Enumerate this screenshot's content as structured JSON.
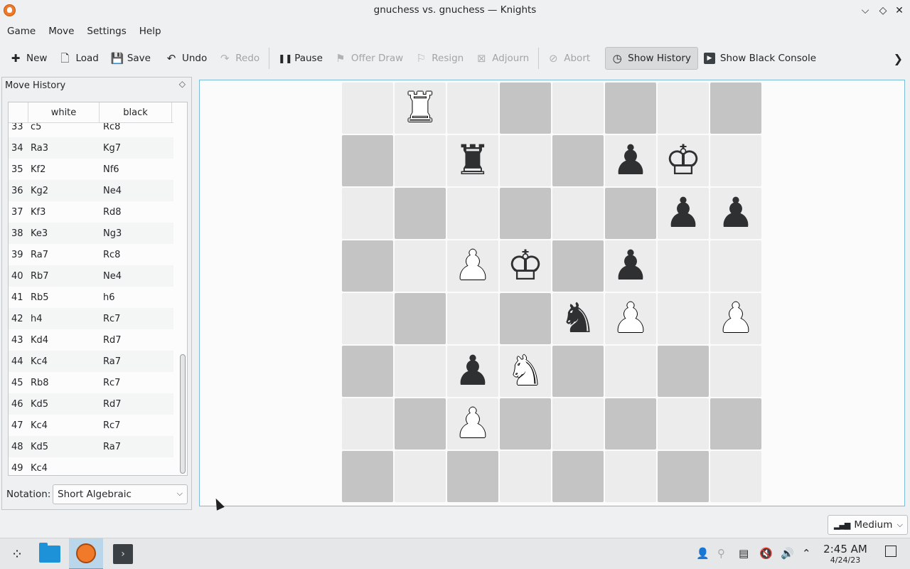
{
  "window": {
    "title": "gnuchess vs. gnuchess — Knights",
    "minimize_glyph": "⌵",
    "maximize_glyph": "◇",
    "close_glyph": "✕"
  },
  "menubar": [
    {
      "label": "Game"
    },
    {
      "label": "Move"
    },
    {
      "label": "Settings"
    },
    {
      "label": "Help"
    }
  ],
  "toolbar": [
    {
      "label": "New",
      "icon": "new-icon",
      "glyph": "✚",
      "enabled": true
    },
    {
      "label": "Load",
      "icon": "load-icon",
      "glyph": "🗋",
      "enabled": true
    },
    {
      "label": "Save",
      "icon": "save-icon",
      "glyph": "💾",
      "enabled": true
    },
    {
      "label": "Undo",
      "icon": "undo-icon",
      "glyph": "↶",
      "enabled": true
    },
    {
      "label": "Redo",
      "icon": "redo-icon",
      "glyph": "↷",
      "enabled": false
    },
    {
      "label": "Pause",
      "icon": "pause-icon",
      "glyph": "❚❚",
      "enabled": true
    },
    {
      "label": "Offer Draw",
      "icon": "flag-icon",
      "glyph": "⚑",
      "enabled": false
    },
    {
      "label": "Resign",
      "icon": "resign-flag-icon",
      "glyph": "⚐",
      "enabled": false
    },
    {
      "label": "Adjourn",
      "icon": "adjourn-icon",
      "glyph": "⊠",
      "enabled": false
    },
    {
      "label": "Abort",
      "icon": "abort-icon",
      "glyph": "⊘",
      "enabled": false
    },
    {
      "label": "Show History",
      "icon": "history-clock-icon",
      "glyph": "◷",
      "enabled": true,
      "active": true
    },
    {
      "label": "Show Black Console",
      "icon": "console-icon",
      "glyph": "▶",
      "enabled": true
    }
  ],
  "history_dock": {
    "title": "Move History",
    "columns": {
      "white": "white",
      "black": "black"
    },
    "moves": [
      {
        "n": "33",
        "w": "c5",
        "b": "Rc8"
      },
      {
        "n": "34",
        "w": "Ra3",
        "b": "Kg7"
      },
      {
        "n": "35",
        "w": "Kf2",
        "b": "Nf6"
      },
      {
        "n": "36",
        "w": "Kg2",
        "b": "Ne4"
      },
      {
        "n": "37",
        "w": "Kf3",
        "b": "Rd8"
      },
      {
        "n": "38",
        "w": "Ke3",
        "b": "Ng3"
      },
      {
        "n": "39",
        "w": "Ra7",
        "b": "Rc8"
      },
      {
        "n": "40",
        "w": "Rb7",
        "b": "Ne4"
      },
      {
        "n": "41",
        "w": "Rb5",
        "b": "h6"
      },
      {
        "n": "42",
        "w": "h4",
        "b": "Rc7"
      },
      {
        "n": "43",
        "w": "Kd4",
        "b": "Rd7"
      },
      {
        "n": "44",
        "w": "Kc4",
        "b": "Ra7"
      },
      {
        "n": "45",
        "w": "Rb8",
        "b": "Rc7"
      },
      {
        "n": "46",
        "w": "Kd5",
        "b": "Rd7"
      },
      {
        "n": "47",
        "w": "Kc4",
        "b": "Rc7"
      },
      {
        "n": "48",
        "w": "Kd5",
        "b": "Ra7"
      },
      {
        "n": "49",
        "w": "Kc4",
        "b": ""
      }
    ],
    "notation_label": "Notation:",
    "notation_value": "Short Algebraic"
  },
  "board": {
    "pieces": [
      {
        "sq": "b8",
        "color": "white",
        "type": "rook",
        "glyph": "♜"
      },
      {
        "sq": "c7",
        "color": "black",
        "type": "rook",
        "glyph": "♜"
      },
      {
        "sq": "f7",
        "color": "black",
        "type": "pawn",
        "glyph": "♟"
      },
      {
        "sq": "g7",
        "color": "white-outline",
        "type": "king",
        "glyph": "♔"
      },
      {
        "sq": "g6",
        "color": "black",
        "type": "pawn",
        "glyph": "♟"
      },
      {
        "sq": "h6",
        "color": "black",
        "type": "pawn",
        "glyph": "♟"
      },
      {
        "sq": "c5",
        "color": "white",
        "type": "pawn",
        "glyph": "♟"
      },
      {
        "sq": "d5",
        "color": "white-outline",
        "type": "king",
        "glyph": "♔"
      },
      {
        "sq": "f5",
        "color": "black",
        "type": "pawn",
        "glyph": "♟"
      },
      {
        "sq": "e4",
        "color": "black",
        "type": "knight",
        "glyph": "♞"
      },
      {
        "sq": "f4",
        "color": "white",
        "type": "pawn",
        "glyph": "♟"
      },
      {
        "sq": "h4",
        "color": "white",
        "type": "pawn",
        "glyph": "♟"
      },
      {
        "sq": "c3",
        "color": "black",
        "type": "pawn",
        "glyph": "♟"
      },
      {
        "sq": "d3",
        "color": "white",
        "type": "knight",
        "glyph": "♞"
      },
      {
        "sq": "c2",
        "color": "white",
        "type": "pawn",
        "glyph": "♟"
      }
    ],
    "dark_squares": [
      "d8",
      "f8",
      "h8",
      "a7",
      "e7",
      "b6",
      "d6",
      "f6",
      "a5",
      "e5",
      "b4",
      "d4",
      "a3",
      "e3",
      "g3",
      "b2",
      "d2",
      "f2",
      "h2",
      "a1",
      "c1",
      "e1",
      "g1"
    ]
  },
  "difficulty": {
    "label": "Medium",
    "icon": "signal-bars-icon"
  },
  "taskbar": {
    "tray_icons": [
      "user-icon",
      "network-icon",
      "clipboard-icon",
      "speaker-muted-icon",
      "volume-icon",
      "chevron-up-icon"
    ],
    "time": "2:45 AM",
    "date": "4/24/23"
  }
}
